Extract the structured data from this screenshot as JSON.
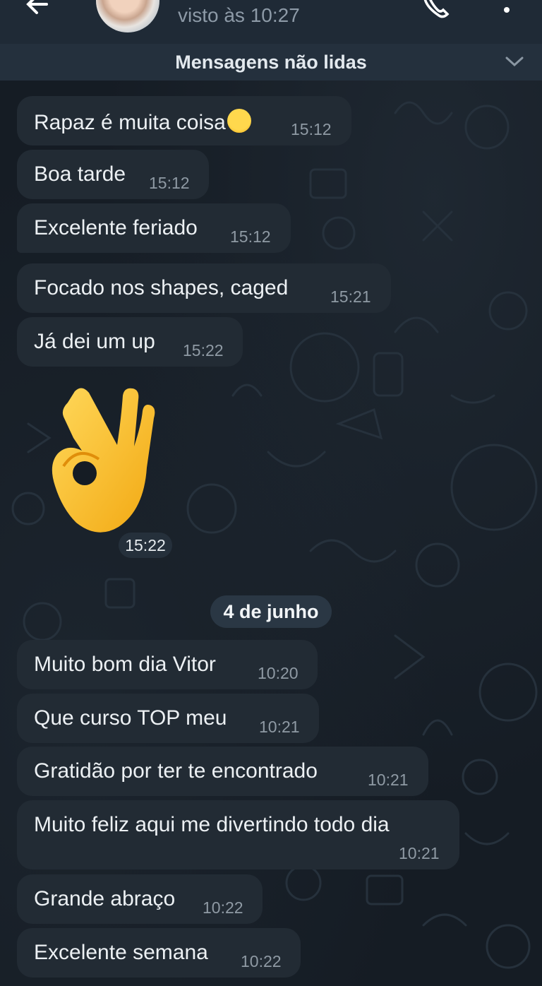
{
  "header": {
    "status": "visto às 10:27"
  },
  "banner": {
    "unread_label": "Mensagens não lidas"
  },
  "messages_day1": [
    {
      "text": "Rapaz é muita coisa",
      "time": "15:12"
    },
    {
      "text": "Boa tarde",
      "time": "15:12"
    },
    {
      "text": "Excelente feriado",
      "time": "15:12"
    },
    {
      "text": "Focado nos shapes, caged",
      "time": "15:21"
    },
    {
      "text": "Já dei um up",
      "time": "15:22"
    }
  ],
  "sticker": {
    "time": "15:22"
  },
  "date_separator": "4 de junho",
  "messages_day2": [
    {
      "text": "Muito bom dia Vitor",
      "time": "10:20"
    },
    {
      "text": "Que curso TOP meu",
      "time": "10:21"
    },
    {
      "text": "Gratidão por ter te encontrado",
      "time": "10:21"
    },
    {
      "text": "Muito feliz aqui me divertindo todo dia",
      "time": "10:21"
    },
    {
      "text": "Grande abraço",
      "time": "10:22"
    },
    {
      "text": "Excelente semana",
      "time": "10:22"
    }
  ],
  "colors": {
    "background": "#151c24",
    "bubble": "#222b34",
    "header": "#1f2a36"
  }
}
